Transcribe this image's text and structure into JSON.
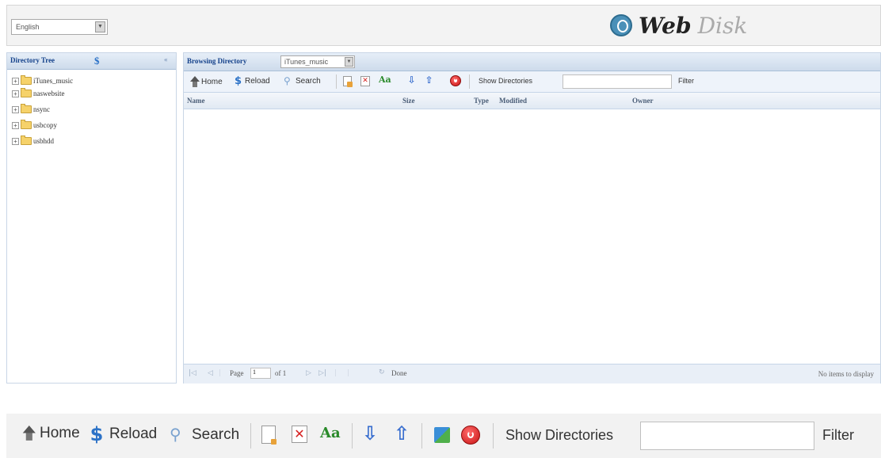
{
  "header": {
    "language": "English",
    "logo_web": "Web",
    "logo_disk": "Disk"
  },
  "tree": {
    "title": "Directory Tree",
    "items": [
      "iTunes_music",
      "naswebsite",
      "nsync",
      "usbcopy",
      "usbhdd"
    ]
  },
  "browser": {
    "label": "Browsing Directory",
    "directory": "iTunes_music",
    "columns": [
      "Name",
      "Size",
      "Type",
      "Modified",
      "Owner"
    ]
  },
  "toolbar": {
    "home": "Home",
    "reload": "Reload",
    "search": "Search",
    "show_directories": "Show Directories",
    "filter": "Filter",
    "filter_value": ""
  },
  "pager": {
    "page_label": "Page",
    "page_value": "1",
    "of_label": "of 1",
    "done": "Done",
    "empty": "No items to display"
  }
}
